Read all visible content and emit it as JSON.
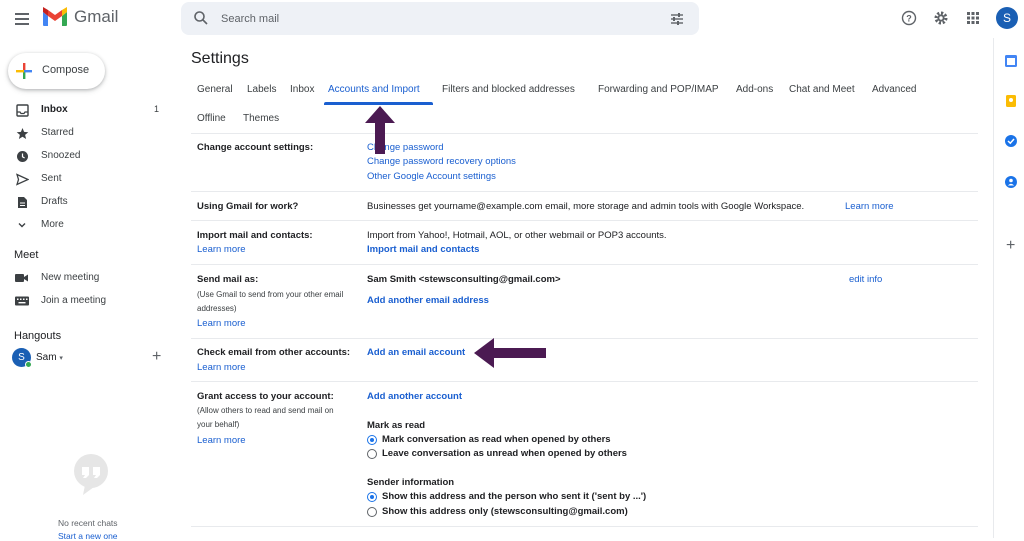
{
  "header": {
    "app_name": "Gmail",
    "search_placeholder": "Search mail",
    "avatar_letter": "S"
  },
  "sidebar": {
    "compose_label": "Compose",
    "items": [
      {
        "label": "Inbox",
        "count": "1",
        "icon": "inbox-icon"
      },
      {
        "label": "Starred",
        "icon": "star-icon"
      },
      {
        "label": "Snoozed",
        "icon": "clock-icon"
      },
      {
        "label": "Sent",
        "icon": "send-icon"
      },
      {
        "label": "Drafts",
        "icon": "file-icon"
      },
      {
        "label": "More",
        "icon": "chevron-down-icon"
      }
    ],
    "meet": {
      "title": "Meet",
      "items": [
        {
          "label": "New meeting",
          "icon": "video-icon"
        },
        {
          "label": "Join a meeting",
          "icon": "keyboard-icon"
        }
      ]
    },
    "hangouts": {
      "title": "Hangouts",
      "user": "Sam",
      "user_letter": "S",
      "no_chats": "No recent chats",
      "start_new": "Start a new one"
    }
  },
  "settings": {
    "title": "Settings",
    "tabs": [
      "General",
      "Labels",
      "Inbox",
      "Accounts and Import",
      "Filters and blocked addresses",
      "Forwarding and POP/IMAP",
      "Add-ons",
      "Chat and Meet",
      "Advanced",
      "Offline",
      "Themes"
    ],
    "active_tab": "Accounts and Import",
    "rows": {
      "change_account": {
        "label": "Change account settings:",
        "links": [
          "Change password",
          "Change password recovery options",
          "Other Google Account settings"
        ]
      },
      "work": {
        "label": "Using Gmail for work?",
        "text": "Businesses get yourname@example.com email, more storage and admin tools with Google Workspace.",
        "link": "Learn more"
      },
      "import": {
        "label": "Import mail and contacts:",
        "learn_more": "Learn more",
        "text": "Import from Yahoo!, Hotmail, AOL, or other webmail or POP3 accounts.",
        "action": "Import mail and contacts"
      },
      "send_as": {
        "label": "Send mail as:",
        "sub1": "(Use Gmail to send from your other email",
        "sub2": "addresses)",
        "learn_more": "Learn more",
        "address": "Sam Smith <stewsconsulting@gmail.com>",
        "edit": "edit info",
        "add": "Add another email address"
      },
      "check_email": {
        "label": "Check email from other accounts:",
        "learn_more": "Learn more",
        "action": "Add an email account"
      },
      "grant": {
        "label": "Grant access to your account:",
        "sub1": "(Allow others to read and send mail on",
        "sub2": "your behalf)",
        "learn_more": "Learn more",
        "action": "Add another account",
        "mark_title": "Mark as read",
        "mark_opt1": "Mark conversation as read when opened by others",
        "mark_opt2": "Leave conversation as unread when opened by others",
        "sender_title": "Sender information",
        "sender_opt1": "Show this address and the person who sent it ('sent by ...')",
        "sender_opt2": "Show this address only (stewsconsulting@gmail.com)"
      }
    }
  },
  "colors": {
    "link": "#1a5fd0",
    "arrow": "#4b1a52",
    "accent": "#1a73e8"
  }
}
